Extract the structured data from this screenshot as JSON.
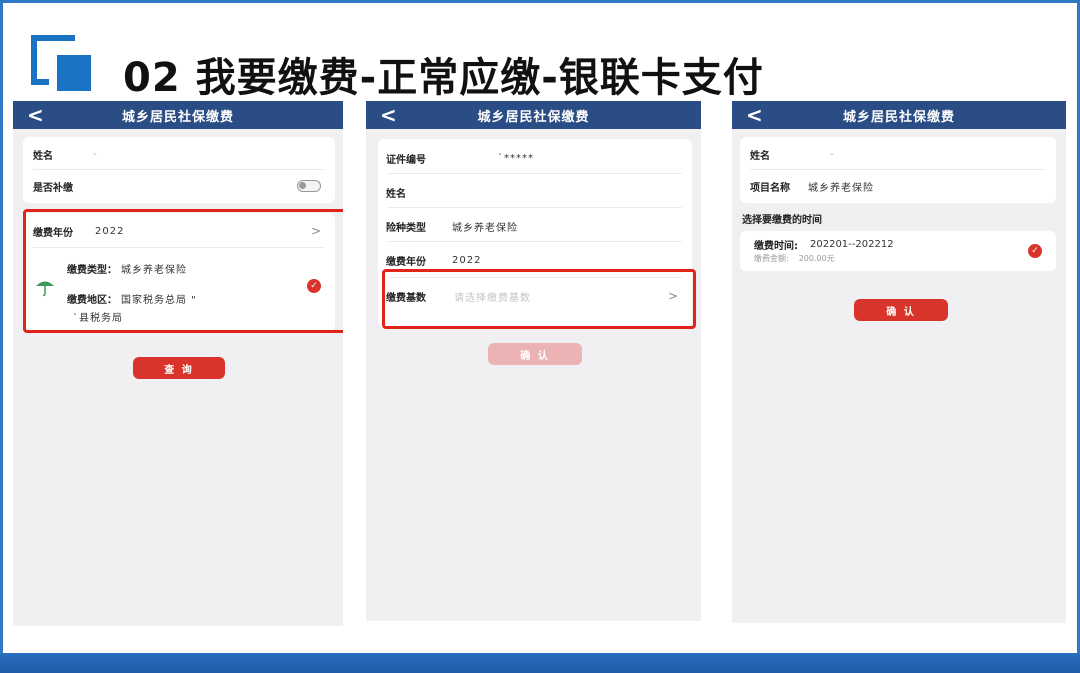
{
  "slide": {
    "title": "02 我要缴费-正常应缴-银联卡支付"
  },
  "phone1": {
    "nav_title": "城乡居民社保缴费",
    "back": "<",
    "name_label": "姓名",
    "name_value": "-",
    "supplement_label": "是否补缴",
    "year_label": "缴费年份",
    "year_value": "2022",
    "type_label": "缴费类型：",
    "type_value": "城乡养老保险",
    "region_label": "缴费地区：",
    "region_value": "国家税务总局 \"",
    "region_value_2": "`县税务局",
    "query_button": "查 询"
  },
  "phone2": {
    "nav_title": "城乡居民社保缴费",
    "back": "<",
    "id_label": "证件编号",
    "id_value": "`*****",
    "name_label": "姓名",
    "insurance_label": "险种类型",
    "insurance_value": "城乡养老保险",
    "year_label": "缴费年份",
    "year_value": "2022",
    "base_label": "缴费基数",
    "base_placeholder": "请选择缴费基数",
    "confirm_button": "确 认"
  },
  "phone3": {
    "nav_title": "城乡居民社保缴费",
    "back": "<",
    "name_label": "姓名",
    "name_value": "-",
    "project_label": "项目名称",
    "project_value": "城乡养老保险",
    "section_title": "选择要缴费的时间",
    "time_label": "缴费时间:",
    "time_value": "202201--202212",
    "amount_label": "缴费金额:",
    "amount_value": "200.00元",
    "confirm_button": "确 认"
  },
  "colors": {
    "nav": "#2b4d86",
    "accent_red": "#d9342b",
    "highlight": "#e2231a",
    "brand_blue": "#1b73c5"
  }
}
